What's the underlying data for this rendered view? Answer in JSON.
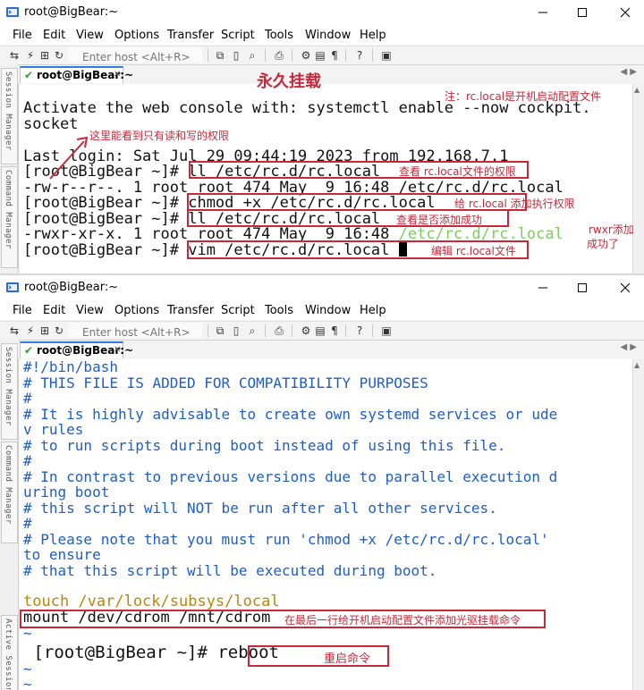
{
  "window_title": "root@BigBear:~",
  "menu": [
    "File",
    "Edit",
    "View",
    "Options",
    "Transfer",
    "Script",
    "Tools",
    "Window",
    "Help"
  ],
  "toolbar": {
    "host_placeholder": "Enter host <Alt+R>"
  },
  "tab": {
    "label": "root@BigBear:~"
  },
  "side_tabs": {
    "session_manager": "Session Manager",
    "command_manager": "Command Manager",
    "active_sessions": "Active Sessions"
  },
  "panel1": {
    "lines": [
      "Activate the web console with: systemctl enable --now cockpit.",
      "socket",
      "",
      "Last login: Sat Jul 29 09:44:19 2023 from 192.168.7.1",
      "[root@BigBear ~]# ll /etc/rc.d/rc.local",
      "-rw-r--r--. 1 root root 474 May  9 16:48 /etc/rc.d/rc.local",
      "[root@BigBear ~]# chmod +x /etc/rc.d/rc.local",
      "[root@BigBear ~]# ll /etc/rc.d/rc.local",
      "-rwxr-xr-x. 1 root root 474 May  9 16:48 ",
      "[root@BigBear ~]# vim /etc/rc.d/rc.local "
    ],
    "green_path": "/etc/rc.d/rc.local",
    "annotations": {
      "title": "永久挂载",
      "note": "注：rc.local是开机启动配置文件",
      "arrow_note": "这里能看到只有读和写的权限",
      "ll_note": "查看 rc.local文件的权限",
      "chmod_note": "给 rc.local 添加执行权限",
      "check_note": "查看是否添加成功",
      "rwxr_line1": "rwxr添加",
      "rwxr_line2": "成功了",
      "vim_note": "编辑 rc.local文件"
    }
  },
  "panel2": {
    "lines": [
      "#!/bin/bash",
      "# THIS FILE IS ADDED FOR COMPATIBILITY PURPOSES",
      "#",
      "# It is highly advisable to create own systemd services or ude",
      "v rules",
      "# to run scripts during boot instead of using this file.",
      "#",
      "# In contrast to previous versions due to parallel execution d",
      "uring boot",
      "# this script will NOT be run after all other services.",
      "#",
      "# Please note that you must run 'chmod +x /etc/rc.d/rc.local'",
      "to ensure",
      "# that this script will be executed during boot.",
      "",
      "touch /var/lock/subsys/local",
      "mount /dev/cdrom /mnt/cdrom",
      "~",
      " [root@BigBear ~]# reboot",
      "~",
      "~"
    ],
    "annotations": {
      "mount_note": "在最后一行给开机启动配置文件添加光驱挂载命令",
      "reboot_note": "重启命令"
    }
  },
  "colors": {
    "annotation_red": "#c8283a",
    "comment_blue": "#1f5dc8",
    "accent_blue": "#2f7de1",
    "path_green": "#7bd05a"
  }
}
